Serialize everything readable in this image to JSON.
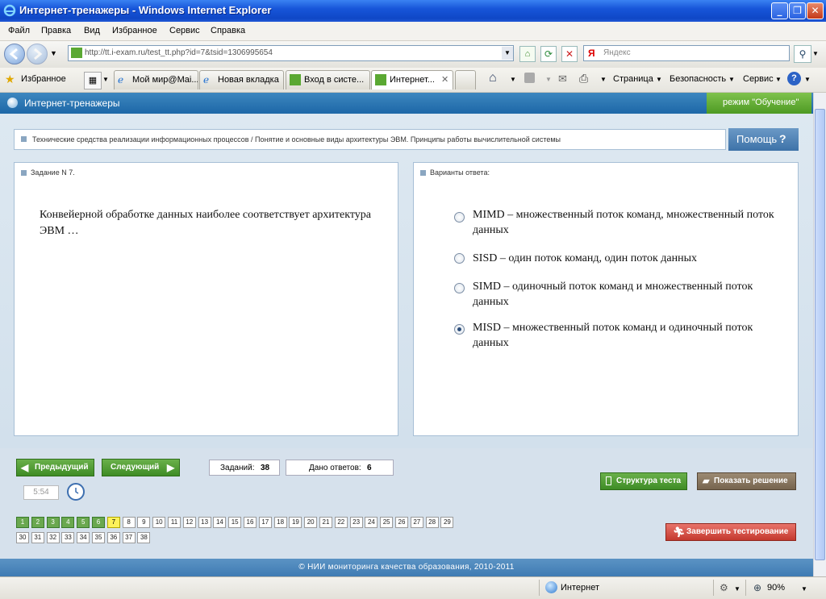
{
  "window": {
    "title": "Интернет-тренажеры - Windows Internet Explorer",
    "controls": [
      "_",
      "❐",
      "✕"
    ]
  },
  "menu": [
    "Файл",
    "Правка",
    "Вид",
    "Избранное",
    "Сервис",
    "Справка"
  ],
  "address": {
    "url": "http://tt.i-exam.ru/test_tt.php?id=7&tsid=1306995654",
    "search_placeholder": "Яндекс"
  },
  "favorites_label": "Избранное",
  "tabs": [
    {
      "label": "Мой мир@Mai..."
    },
    {
      "label": "Новая вкладка"
    },
    {
      "label": "Вход в систе..."
    },
    {
      "label": "Интернет..."
    }
  ],
  "commands": {
    "page": "Страница",
    "safety": "Безопасность",
    "tools": "Сервис"
  },
  "app": {
    "title": "Интернет-тренажеры",
    "mode": "режим \"Обучение\"",
    "breadcrumb": "Технические средства реализации информационных процессов / Понятие и основные виды архитектуры ЭВМ. Принципы работы вычислительной системы",
    "help_label": "Помощь",
    "help_icon": "?",
    "task_header": "Задание N 7.",
    "question": "Конвейерной обработке данных наиболее соответствует архитектура ЭВМ …",
    "answers_header": "Варианты ответа:",
    "options": [
      {
        "text": "MIMD – множественный поток команд, множественный поток данных",
        "selected": false
      },
      {
        "text": "SISD – один поток команд, один поток данных",
        "selected": false
      },
      {
        "text": "SIMD – одиночный поток команд и множественный поток данных",
        "selected": false
      },
      {
        "text": "MISD – множественный поток команд и одиночный поток данных",
        "selected": true
      }
    ],
    "prev_label": "Предыдущий",
    "next_label": "Следующий",
    "tasks_label": "Заданий:",
    "tasks_count": "38",
    "answered_label": "Дано ответов:",
    "answered_count": "6",
    "timer": "5:54",
    "structure_label": "Структура теста",
    "solution_label": "Показать решение",
    "finish_label": "Завершить тестирование",
    "footer": "© НИИ мониторинга качества образования, 2010-2011",
    "task_numbers": {
      "total": 38,
      "done": [
        1,
        2,
        3,
        4,
        5,
        6
      ],
      "current": 7
    }
  },
  "status": {
    "zone": "Интернет",
    "zoom": "90%"
  },
  "colors": {
    "title_blue": "#1755d9",
    "app_blue": "#2d72ae",
    "green": "#4d9a23",
    "red": "#c4392e"
  }
}
